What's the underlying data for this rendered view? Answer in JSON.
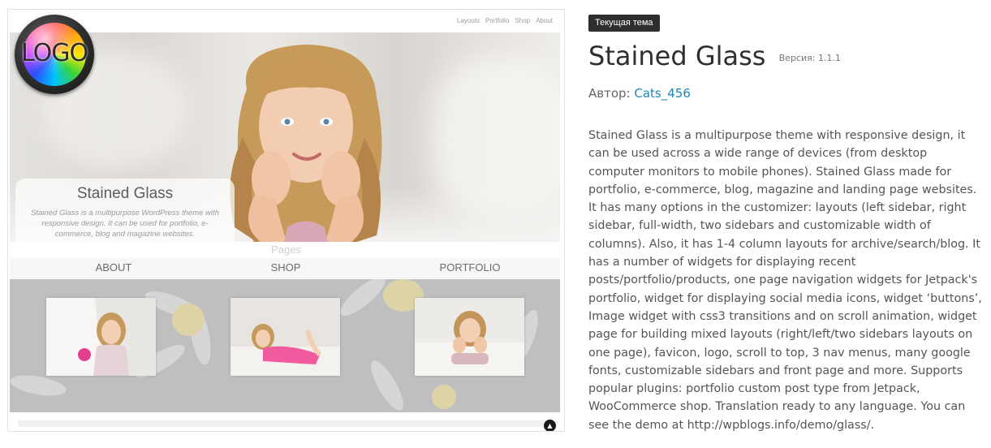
{
  "preview": {
    "nav": [
      "Layouts",
      "Portfolio",
      "Shop",
      "About"
    ],
    "logo_text": "LOGO",
    "caption_title": "Stained Glass",
    "caption_text": "Stained Glass is a multipurpose WordPress theme with responsive design. It can be used for portfolio, e-commerce, blog and magazine websites.",
    "pages_title": "Pages",
    "page_links": [
      "ABOUT",
      "SHOP",
      "PORTFOLIO"
    ],
    "to_top_glyph": "▲"
  },
  "theme": {
    "badge": "Текущая тема",
    "name": "Stained Glass",
    "version_label": "Версия: 1.1.1",
    "author_label": "Автор:",
    "author_name": "Cats_456",
    "description": "Stained Glass is a multipurpose theme with responsive design, it can be used across a wide range of devices (from desktop computer monitors to mobile phones). Stained Glass made for portfolio, e-commerce, blog, magazine and landing page websites. It has many options in the customizer: layouts (left sidebar, right sidebar, full-width, two sidebars and customizable width of columns). Also, it has 1-4 column layouts for archive/search/blog. It has a number of widgets for displaying recent posts/portfolio/products, one page navigation widgets for Jetpack's portfolio, widget for displaying social media icons, widget ‘buttons’, Image widget with css3 transitions and on scroll animation, widget page for building mixed layouts (right/left/two sidebars layouts on one page), favicon, logo, scroll to top, 3 nav menus, many google fonts, customizable sidebars and front page and more. Supports popular plugins: portfolio custom post type from Jetpack, WooCommerce shop. Translation ready to any language. You can see the demo at http://wpblogs.info/demo/glass/."
  },
  "colors": {
    "badge_bg": "#2e2e2e",
    "link": "#1e87b8",
    "text": "#555555"
  }
}
